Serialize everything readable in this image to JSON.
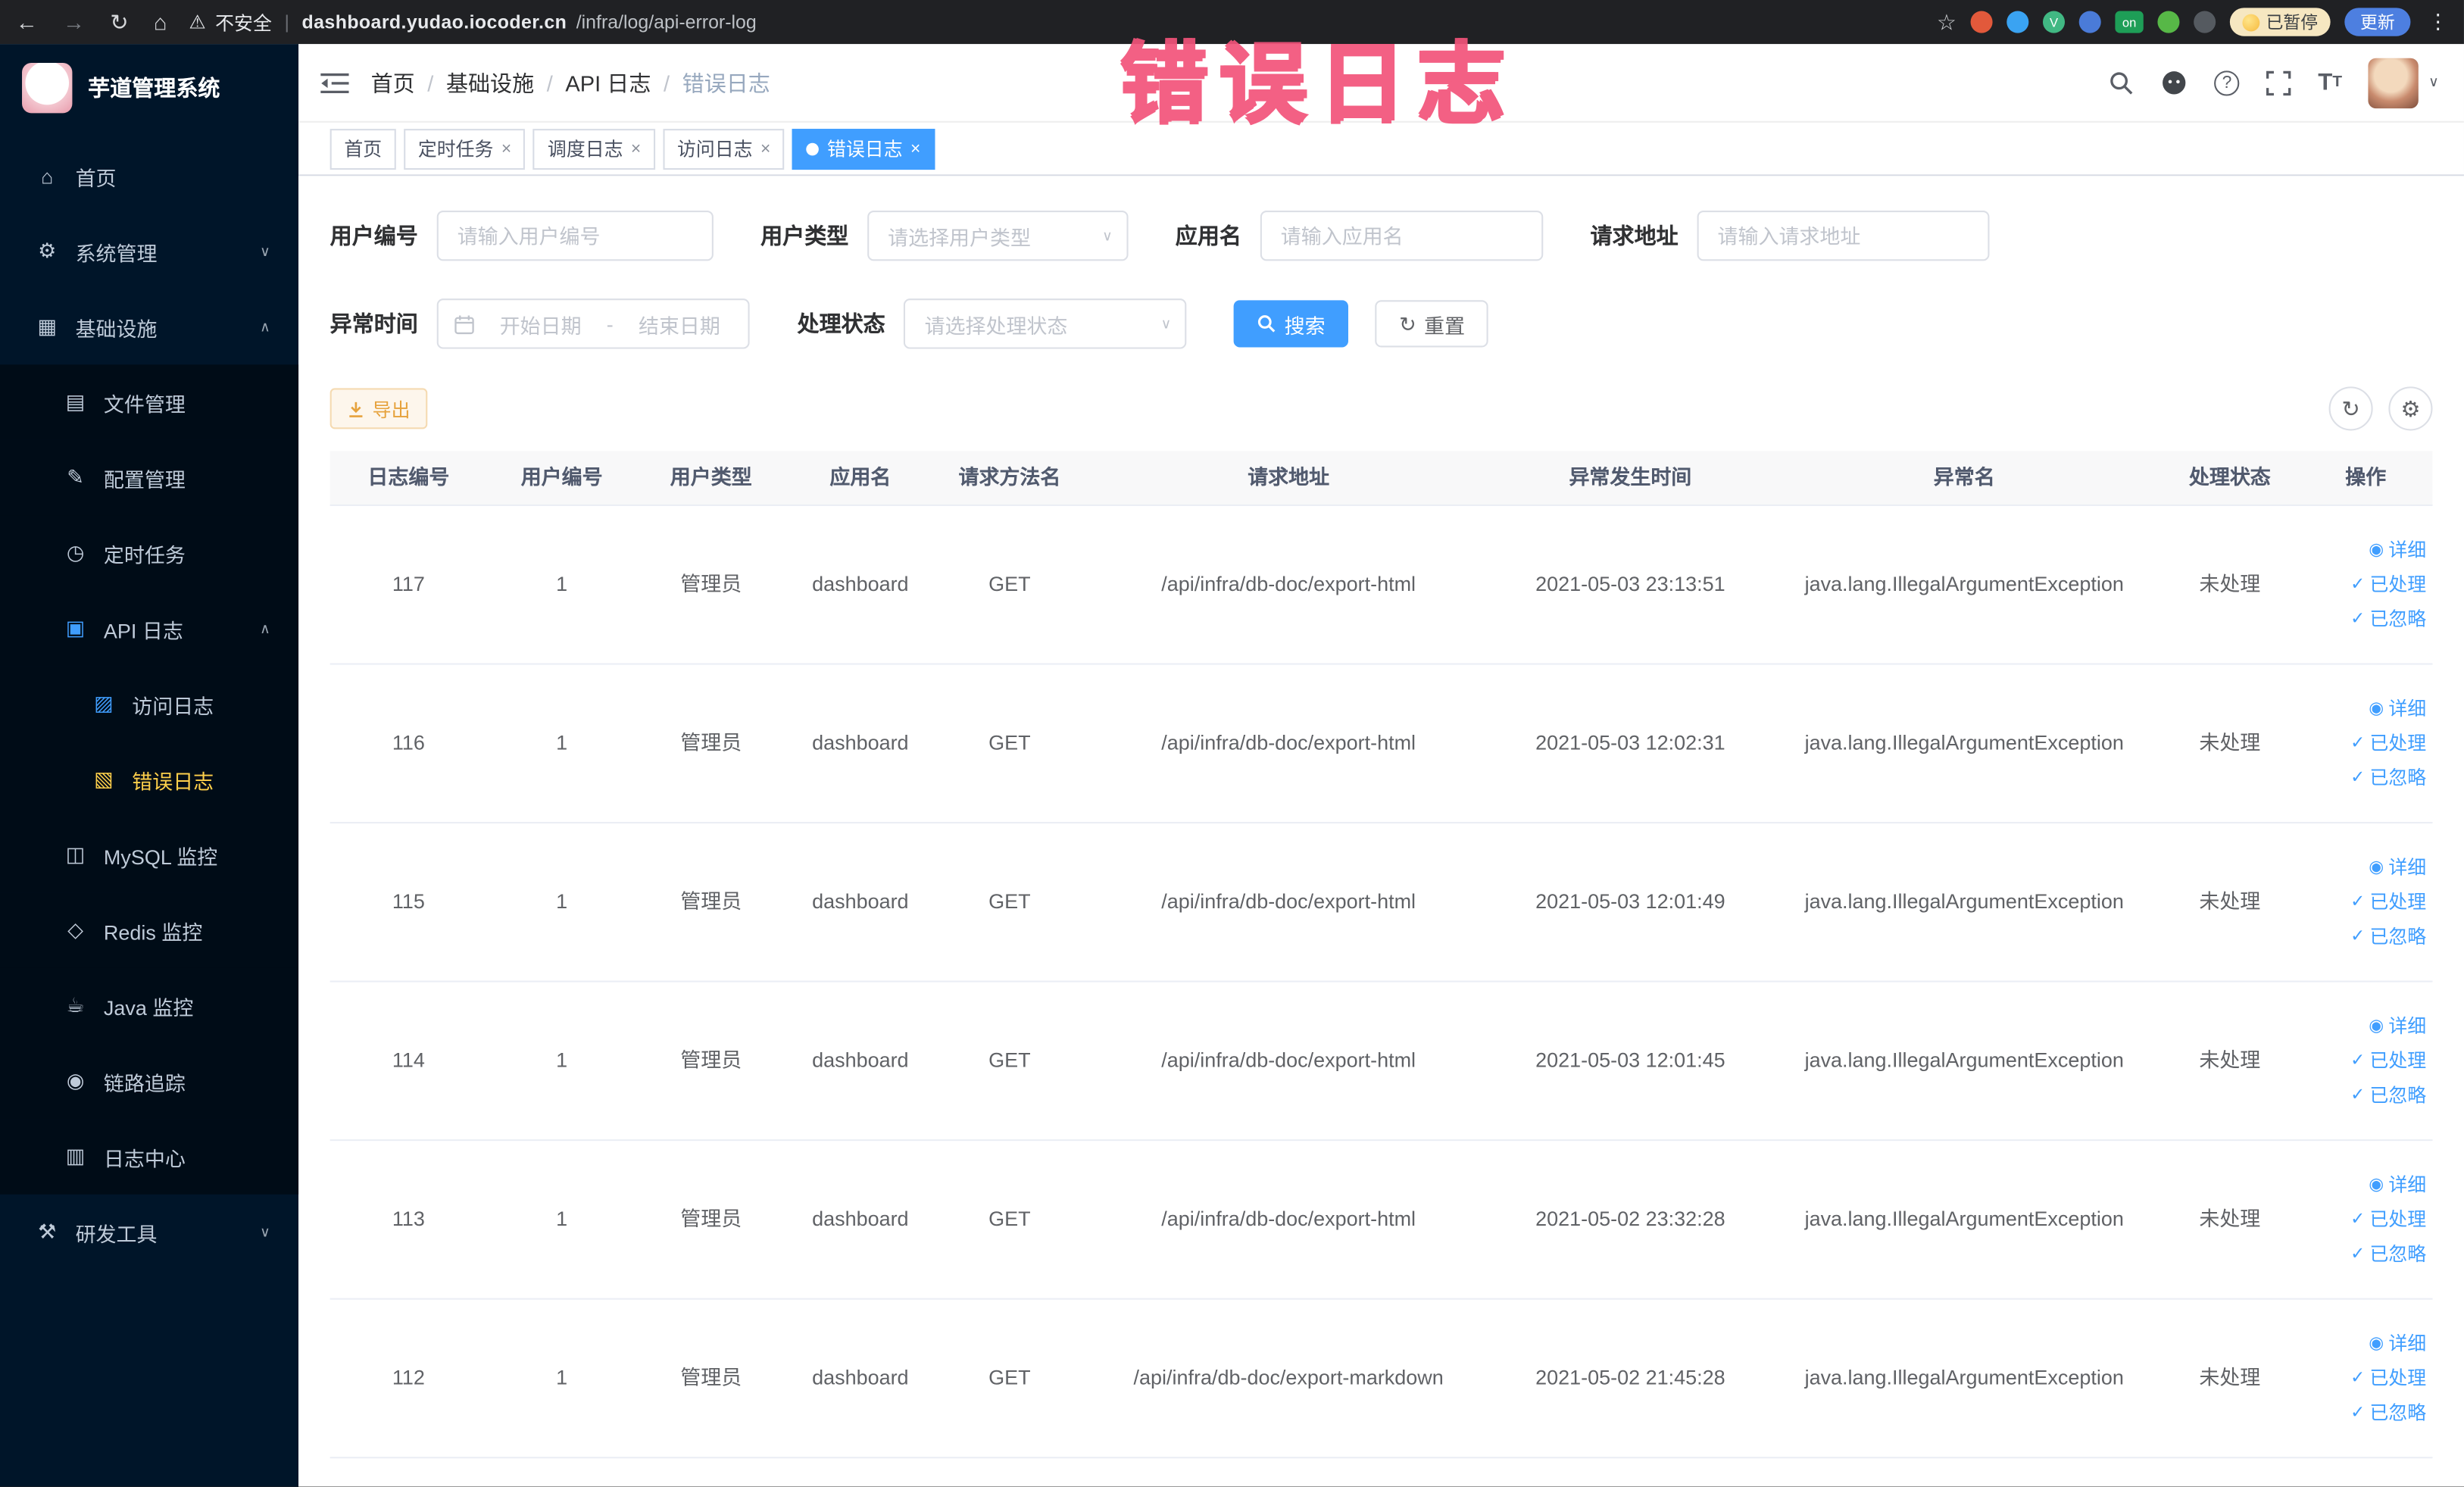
{
  "browser": {
    "security_label": "不安全",
    "url_host": "dashboard.yudao.iocoder.cn",
    "url_path": "/infra/log/api-error-log",
    "paused_badge": "已暂停",
    "update_button": "更新",
    "extension_on_badge": "on"
  },
  "watermark_text": "错误日志",
  "sidebar": {
    "logo_title": "芋道管理系统",
    "items": [
      {
        "label": "首页"
      },
      {
        "label": "系统管理"
      },
      {
        "label": "基础设施"
      },
      {
        "label": "文件管理"
      },
      {
        "label": "配置管理"
      },
      {
        "label": "定时任务"
      },
      {
        "label": "API 日志"
      },
      {
        "label": "访问日志"
      },
      {
        "label": "错误日志"
      },
      {
        "label": "MySQL 监控"
      },
      {
        "label": "Redis 监控"
      },
      {
        "label": "Java 监控"
      },
      {
        "label": "链路追踪"
      },
      {
        "label": "日志中心"
      },
      {
        "label": "研发工具"
      }
    ]
  },
  "breadcrumb": {
    "separator": "/",
    "items": [
      "首页",
      "基础设施",
      "API 日志",
      "错误日志"
    ]
  },
  "tabs": [
    {
      "label": "首页"
    },
    {
      "label": "定时任务"
    },
    {
      "label": "调度日志"
    },
    {
      "label": "访问日志"
    },
    {
      "label": "错误日志"
    }
  ],
  "filters": {
    "user_id_label": "用户编号",
    "user_id_placeholder": "请输入用户编号",
    "user_type_label": "用户类型",
    "user_type_placeholder": "请选择用户类型",
    "app_name_label": "应用名",
    "app_name_placeholder": "请输入应用名",
    "request_url_label": "请求地址",
    "request_url_placeholder": "请输入请求地址",
    "exception_time_label": "异常时间",
    "date_start_placeholder": "开始日期",
    "date_separator": "-",
    "date_end_placeholder": "结束日期",
    "process_status_label": "处理状态",
    "process_status_placeholder": "请选择处理状态",
    "search_button": "搜索",
    "reset_button": "重置"
  },
  "toolbar": {
    "export_button": "导出"
  },
  "table": {
    "headers": [
      "日志编号",
      "用户编号",
      "用户类型",
      "应用名",
      "请求方法名",
      "请求地址",
      "异常发生时间",
      "异常名",
      "处理状态",
      "操作"
    ],
    "action_detail": "详细",
    "action_processed": "已处理",
    "action_ignored": "已忽略",
    "rows": [
      {
        "id": "117",
        "user_id": "1",
        "user_type": "管理员",
        "app": "dashboard",
        "method": "GET",
        "url": "/api/infra/db-doc/export-html",
        "time": "2021-05-03 23:13:51",
        "exception": "java.lang.IllegalArgumentException",
        "status": "未处理"
      },
      {
        "id": "116",
        "user_id": "1",
        "user_type": "管理员",
        "app": "dashboard",
        "method": "GET",
        "url": "/api/infra/db-doc/export-html",
        "time": "2021-05-03 12:02:31",
        "exception": "java.lang.IllegalArgumentException",
        "status": "未处理"
      },
      {
        "id": "115",
        "user_id": "1",
        "user_type": "管理员",
        "app": "dashboard",
        "method": "GET",
        "url": "/api/infra/db-doc/export-html",
        "time": "2021-05-03 12:01:49",
        "exception": "java.lang.IllegalArgumentException",
        "status": "未处理"
      },
      {
        "id": "114",
        "user_id": "1",
        "user_type": "管理员",
        "app": "dashboard",
        "method": "GET",
        "url": "/api/infra/db-doc/export-html",
        "time": "2021-05-03 12:01:45",
        "exception": "java.lang.IllegalArgumentException",
        "status": "未处理"
      },
      {
        "id": "113",
        "user_id": "1",
        "user_type": "管理员",
        "app": "dashboard",
        "method": "GET",
        "url": "/api/infra/db-doc/export-html",
        "time": "2021-05-02 23:32:28",
        "exception": "java.lang.IllegalArgumentException",
        "status": "未处理"
      },
      {
        "id": "112",
        "user_id": "1",
        "user_type": "管理员",
        "app": "dashboard",
        "method": "GET",
        "url": "/api/infra/db-doc/export-markdown",
        "time": "2021-05-02 21:45:28",
        "exception": "java.lang.IllegalArgumentException",
        "status": "未处理"
      }
    ]
  }
}
